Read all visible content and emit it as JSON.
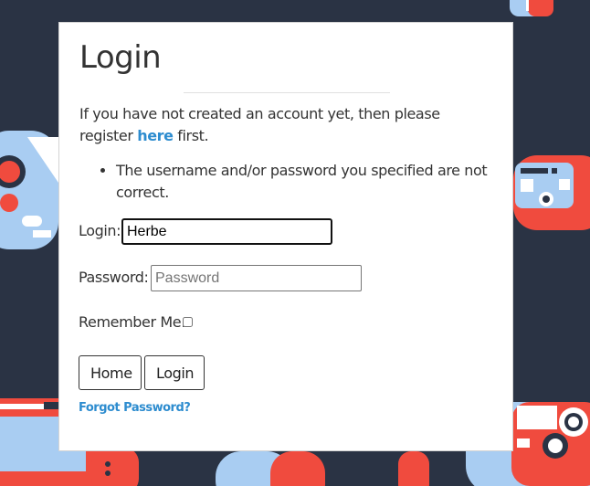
{
  "login_panel": {
    "title": "Login",
    "intro_before_link": "If you have not created an account yet, then please register ",
    "register_link": "here",
    "intro_after_link": " first.",
    "errors": [
      "The username and/or password you specified are not correct."
    ],
    "login_label": "Login:",
    "login_value": "Herbe",
    "password_label": "Password:",
    "password_placeholder": "Password",
    "remember_label": "Remember Me:",
    "home_button": "Home",
    "login_button": "Login",
    "forgot_link": "Forgot Password?"
  },
  "colors": {
    "background": "#2a3344",
    "accent_red": "#f04b3e",
    "accent_light_blue": "#a9cdf2",
    "link": "#2d8ccf"
  }
}
